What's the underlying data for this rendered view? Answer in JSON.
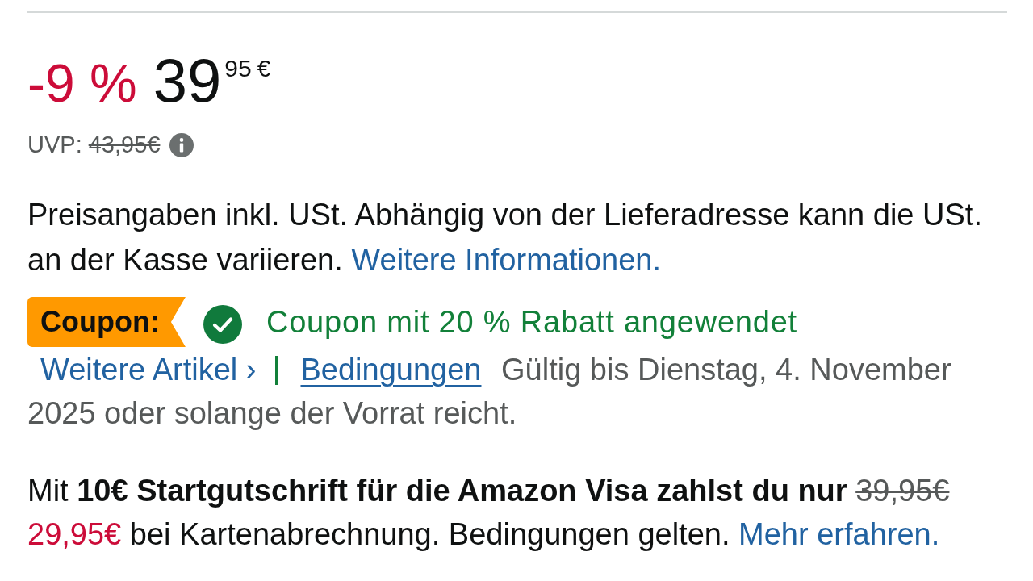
{
  "price": {
    "discount": "-9 %",
    "whole": "39",
    "fraction": "95",
    "currency": "€"
  },
  "list_price": {
    "label": "UVP:",
    "value": "43,95€"
  },
  "tax_note": {
    "text": "Preisangaben inkl. USt. Abhängig von der Lieferadresse kann die USt. an der Kasse variieren.",
    "link": "Weitere Informationen."
  },
  "coupon": {
    "badge": "Coupon:",
    "applied": true,
    "message": "Coupon mit 20 % Rabatt angewendet",
    "more_items_link": "Weitere Artikel ›",
    "terms_link": "Bedingungen",
    "validity": "Gültig bis Dienstag, 4. November 2025 oder solange der Vorrat reicht."
  },
  "card_offer": {
    "text": "Mit **10€ Startgutschrift für die Amazon Visa zahlst du nur**",
    "old_price": "39,95€",
    "new_price": "29,95€",
    "note": "bei Kartenabrechnung. Bedingungen gelten.",
    "link": "Mehr erfahren."
  }
}
